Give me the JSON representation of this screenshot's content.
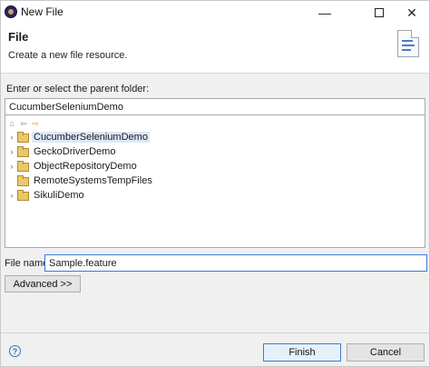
{
  "window": {
    "title": "New File",
    "minimize_glyph": "—",
    "close_glyph": "✕"
  },
  "banner": {
    "title": "File",
    "description": "Create a new file resource."
  },
  "folder": {
    "label": "Enter or select the parent folder:",
    "value": "CucumberSeleniumDemo"
  },
  "tree": {
    "toolbar": {
      "home_icon": "home-icon",
      "back_icon": "back-arrow-icon",
      "forward_icon": "forward-arrow-icon"
    },
    "items": [
      {
        "label": "CucumberSeleniumDemo",
        "expandable": true,
        "selected": true
      },
      {
        "label": "GeckoDriverDemo",
        "expandable": true,
        "selected": false
      },
      {
        "label": "ObjectRepositoryDemo",
        "expandable": true,
        "selected": false
      },
      {
        "label": "RemoteSystemsTempFiles",
        "expandable": false,
        "selected": false
      },
      {
        "label": "SikuliDemo",
        "expandable": true,
        "selected": false
      }
    ],
    "chevron": "›"
  },
  "file_name": {
    "label": "File name:",
    "value": "Sample.feature"
  },
  "buttons": {
    "advanced": "Advanced >>",
    "finish": "Finish",
    "cancel": "Cancel",
    "help": "?"
  },
  "colors": {
    "selection": "#dce8f7",
    "focus_border": "#3c7bd0",
    "folder_icon": "#e8c86a"
  }
}
